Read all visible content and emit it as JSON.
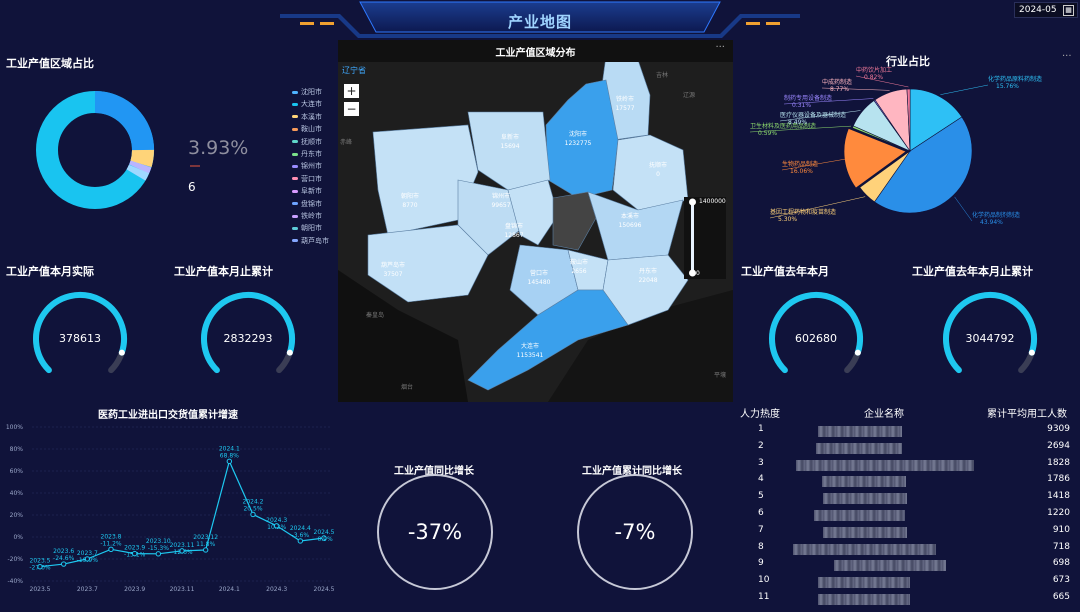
{
  "header": {
    "title": "产业地图",
    "date": "2024-05"
  },
  "region_share": {
    "title": "工业产值区域占比",
    "percent_label": "3.93%",
    "count_label": "6",
    "cities": [
      {
        "name": "沈阳市",
        "color": "#4fb3ff"
      },
      {
        "name": "大连市",
        "color": "#19c4f0"
      },
      {
        "name": "本溪市",
        "color": "#ffd479"
      },
      {
        "name": "鞍山市",
        "color": "#f79a5a"
      },
      {
        "name": "抚顺市",
        "color": "#5fd6c9"
      },
      {
        "name": "丹东市",
        "color": "#7be08a"
      },
      {
        "name": "锦州市",
        "color": "#9a8cff"
      },
      {
        "name": "营口市",
        "color": "#ff8fb3"
      },
      {
        "name": "阜新市",
        "color": "#d99bff"
      },
      {
        "name": "盘锦市",
        "color": "#6ea3ff"
      },
      {
        "name": "铁岭市",
        "color": "#c8a0ff"
      },
      {
        "name": "朝阳市",
        "color": "#5dcbd8"
      },
      {
        "name": "葫芦岛市",
        "color": "#85a7ff"
      }
    ]
  },
  "map": {
    "title": "工业产值区域分布",
    "province": "辽宁省",
    "more": "···",
    "zoom_in": "+",
    "zoom_out": "−",
    "legend_max": "1400000",
    "legend_min": "0",
    "neighbors": [
      "吉林",
      "辽源",
      "赤峰",
      "秦皇岛",
      "烟台",
      "平壤"
    ],
    "regions": [
      {
        "name": "铁岭市",
        "value": "17577"
      },
      {
        "name": "沈阳市",
        "value": "1232775"
      },
      {
        "name": "抚顺市",
        "value": "0"
      },
      {
        "name": "阜新市",
        "value": "15694"
      },
      {
        "name": "朝阳市",
        "value": "8770"
      },
      {
        "name": "锦州市",
        "value": "99657"
      },
      {
        "name": "盘锦市",
        "value": "12867"
      },
      {
        "name": "本溪市",
        "value": "150696"
      },
      {
        "name": "葫芦岛市",
        "value": "37507"
      },
      {
        "name": "营口市",
        "value": "145480"
      },
      {
        "name": "鞍山市",
        "value": "2656"
      },
      {
        "name": "丹东市",
        "value": "22048"
      },
      {
        "name": "大连市",
        "value": "1153541"
      }
    ]
  },
  "industry_share": {
    "title": "行业占比",
    "more": "···",
    "slices": [
      {
        "name": "化学药品原料药制造",
        "pct": "15.76%",
        "color": "#2ec0f5"
      },
      {
        "name": "化学药品制剂制造",
        "pct": "43.94%",
        "color": "#2a8fe8"
      },
      {
        "name": "基因工程药物和疫苗制造",
        "pct": "5.30%",
        "color": "#ffd27a"
      },
      {
        "name": "生物药品制造",
        "pct": "16.06%",
        "color": "#ff8a3d"
      },
      {
        "name": "卫生材料及医药用品制造",
        "pct": "0.59%",
        "color": "#8fdc6e"
      },
      {
        "name": "医疗仪器设备及器械制造",
        "pct": "8.49%",
        "color": "#b7e3ef"
      },
      {
        "name": "制药专用设备制造",
        "pct": "0.31%",
        "color": "#9b87ff"
      },
      {
        "name": "中成药制造",
        "pct": "8.77%",
        "color": "#ffb6c1"
      },
      {
        "name": "中药饮片加工",
        "pct": "0.82%",
        "color": "#f27a9a"
      }
    ]
  },
  "gauges": [
    {
      "title": "工业产值本月实际",
      "value": "378613"
    },
    {
      "title": "工业产值本月止累计",
      "value": "2832293"
    },
    {
      "title": "工业产值去年本月",
      "value": "602680"
    },
    {
      "title": "工业产值去年本月止累计",
      "value": "3044792"
    }
  ],
  "growth": [
    {
      "title": "工业产值同比增长",
      "value": "-37%"
    },
    {
      "title": "工业产值累计同比增长",
      "value": "-7%"
    }
  ],
  "chart_data": {
    "type": "line",
    "title": "医药工业进出口交货值累计增速",
    "x": [
      "2023.5",
      "2023.6",
      "2023.7",
      "2023.8",
      "2023.9",
      "2023.10",
      "2023.11",
      "2023.12",
      "2024.1",
      "2024.2",
      "2024.3",
      "2024.4",
      "2024.5"
    ],
    "values": [
      -27.0,
      -24.6,
      -19.9,
      -11.2,
      -15.1,
      -15.3,
      -12.6,
      -11.8,
      68.8,
      20.5,
      10.2,
      -3.6,
      -0.9
    ],
    "value_labels": [
      "-27.0%",
      "-24.6%",
      "-19.9%",
      "-11.2%",
      "-15.1%",
      "-15.3%",
      "-12.6%",
      "11.8%",
      "68.8%",
      "20.5%",
      "10.2%",
      "-3.6%",
      "-0.9%"
    ],
    "x_ticks": [
      "2023.5",
      "2023.7",
      "2023.9",
      "2023.11",
      "2024.1",
      "2024.3",
      "2024.5"
    ],
    "y_ticks": [
      "100%",
      "80%",
      "60%",
      "40%",
      "20%",
      "0%",
      "-20%",
      "-40%"
    ],
    "ylim": [
      -40,
      100
    ],
    "grid": true,
    "color": "#1ec8f0"
  },
  "staff_table": {
    "headers": [
      "人力热度",
      "企业名称",
      "累计平均用工人数"
    ],
    "rows": [
      {
        "rank": "1",
        "value": "9309"
      },
      {
        "rank": "2",
        "value": "2694"
      },
      {
        "rank": "3",
        "value": "1828"
      },
      {
        "rank": "4",
        "value": "1786"
      },
      {
        "rank": "5",
        "value": "1418"
      },
      {
        "rank": "6",
        "value": "1220"
      },
      {
        "rank": "7",
        "value": "910"
      },
      {
        "rank": "8",
        "value": "718"
      },
      {
        "rank": "9",
        "value": "698"
      },
      {
        "rank": "10",
        "value": "673"
      },
      {
        "rank": "11",
        "value": "665"
      }
    ]
  }
}
